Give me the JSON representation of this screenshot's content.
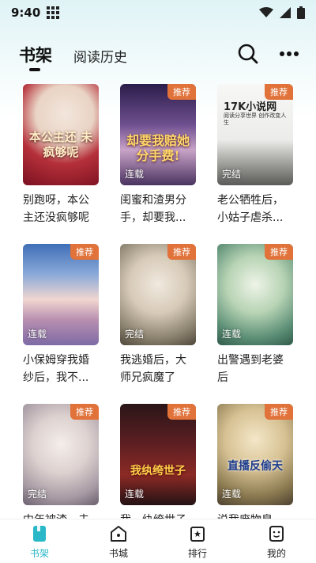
{
  "status_bar": {
    "time": "9:40"
  },
  "header": {
    "tab_bookshelf": "书架",
    "tab_history": "阅读历史"
  },
  "books": [
    {
      "title": "别跑呀，本公主还没疯够呢",
      "title_display": "别跑呀，本公\n主还没疯够呢",
      "badge": "",
      "status": "",
      "cover_text": "本公主还\n未疯够呢"
    },
    {
      "title": "闺蜜和渣男分手，却要我...",
      "title_display": "闺蜜和渣男分\n手，却要我...",
      "badge": "推荐",
      "status": "连载",
      "cover_text": "却要我赔她\n分手费!"
    },
    {
      "title": "老公牺牲后，小姑子虐杀...",
      "title_display": "老公牺牲后，\n小姑子虐杀...",
      "badge": "推荐",
      "status": "完结",
      "cover_brand": "17K小说网",
      "cover_sub": "阅读分享世界 创作改变人生"
    },
    {
      "title": "小保姆穿我婚纱后，我不...",
      "title_display": "小保姆穿我婚\n纱后，我不...",
      "badge": "推荐",
      "status": "连载"
    },
    {
      "title": "我逃婚后，大师兄疯魔了",
      "title_display": "我逃婚后，大\n师兄疯魔了",
      "badge": "推荐",
      "status": "完结"
    },
    {
      "title": "出警遇到老婆后",
      "title_display": "出警遇到老婆\n后",
      "badge": "推荐",
      "status": "连载"
    },
    {
      "title": "中年被渣，未...",
      "title_display": "中年被渣，未",
      "badge": "推荐",
      "status": "完结"
    },
    {
      "title": "我，纨绔世子",
      "title_display": "我，纨绔世子",
      "badge": "推荐",
      "status": "连载",
      "cover_text": "我纨绔世子"
    },
    {
      "title": "说我废物皇子",
      "title_display": "说我废物皇",
      "badge": "推荐",
      "status": "连载",
      "cover_text": "直播反偷天"
    }
  ],
  "bottom_nav": [
    {
      "label": "书架",
      "active": true
    },
    {
      "label": "书城",
      "active": false
    },
    {
      "label": "排行",
      "active": false
    },
    {
      "label": "我的",
      "active": false
    }
  ],
  "colors": {
    "accent": "#2ab7c8",
    "badge": "#e0723a"
  }
}
